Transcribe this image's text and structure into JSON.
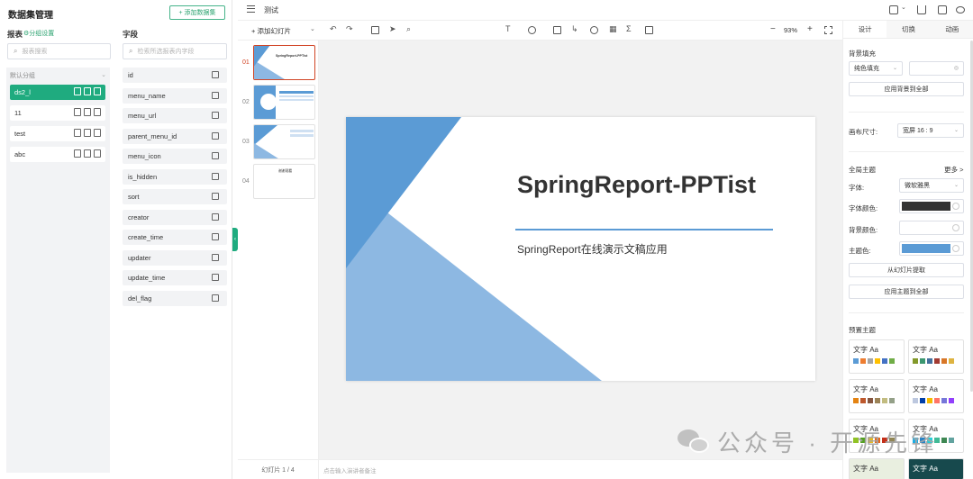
{
  "left": {
    "title": "数据集管理",
    "add_dataset_label": "+ 添加数据集",
    "report_tab": "报表",
    "group_settings": "⚙分组设置",
    "fields_tab": "字段",
    "report_search_placeholder": "报表搜索",
    "field_search_placeholder": "检索所选报表内字段",
    "default_group": "默认分组",
    "reports": [
      "ds2_l",
      "11",
      "test",
      "abc"
    ],
    "fields": [
      "id",
      "menu_name",
      "menu_url",
      "parent_menu_id",
      "menu_icon",
      "is_hidden",
      "sort",
      "creator",
      "create_time",
      "updater",
      "update_time",
      "del_flag"
    ]
  },
  "topbar": {
    "doc_title": "测试"
  },
  "toolbar": {
    "add_slide": "+ 添加幻灯片",
    "zoom": "93%"
  },
  "thumbnails": {
    "numbers": [
      "01",
      "02",
      "03",
      "04"
    ],
    "thumb1_title": "SpringReport-PPTist",
    "thumb4_title": "谢谢观看",
    "footer": "幻灯片 1 / 4",
    "notes_placeholder": "点击输入演讲者备注"
  },
  "slide": {
    "title": "SpringReport-PPTist",
    "subtitle": "SpringReport在线演示文稿应用"
  },
  "right": {
    "tabs": [
      "设计",
      "切换",
      "动画"
    ],
    "bg_fill_label": "背景填充",
    "fill_type": "纯色填充",
    "apply_bg_all": "应用背景到全部",
    "canvas_size_label": "画布尺寸:",
    "canvas_size_value": "宽屏 16 : 9",
    "global_theme_label": "全局主题",
    "more": "更多 >",
    "font_label": "字体:",
    "font_value": "微软雅黑",
    "font_color_label": "字体颜色:",
    "bg_color_label": "背景颜色:",
    "theme_color_label": "主题色:",
    "extract_from_slide": "从幻灯片提取",
    "apply_theme_all": "应用主题到全部",
    "preset_theme_label": "预置主题",
    "theme_text": "文字 Aa",
    "colors": {
      "font": "#333333",
      "background": "#ffffff",
      "theme": "#5b9bd5"
    }
  },
  "watermark": {
    "text": "公众号 · 开源先锋"
  }
}
